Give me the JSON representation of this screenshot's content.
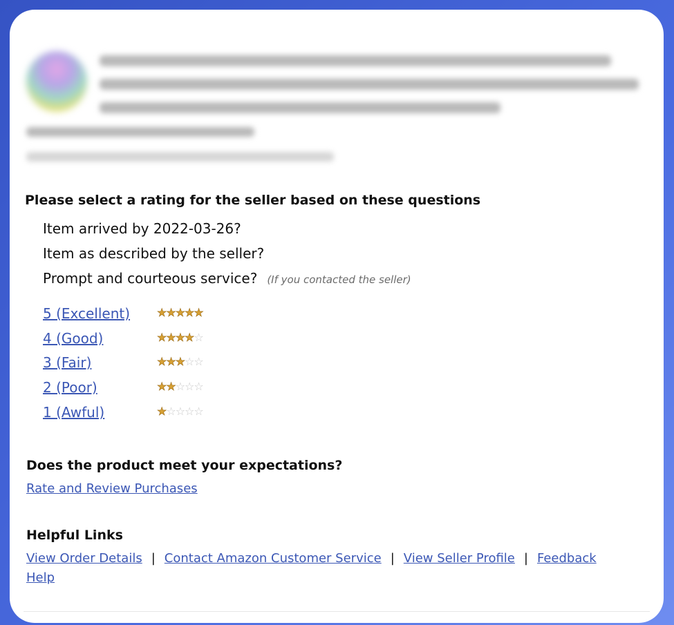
{
  "seller_rating": {
    "title": "Please select a rating for the seller based on these questions",
    "questions": [
      "Item arrived by 2022-03-26?",
      "Item as described by the seller?",
      "Prompt and courteous service?"
    ],
    "question_note": "(If you contacted the seller)",
    "options": [
      {
        "label": "5 (Excellent)",
        "stars": 5
      },
      {
        "label": "4 (Good)",
        "stars": 4
      },
      {
        "label": "3 (Fair)",
        "stars": 3
      },
      {
        "label": "2 (Poor)",
        "stars": 2
      },
      {
        "label": "1 (Awful)",
        "stars": 1
      }
    ],
    "max_stars": 5,
    "star_color": "#d7a033"
  },
  "product_review": {
    "title": "Does the product meet your expectations?",
    "link_label": "Rate and Review Purchases"
  },
  "helpful_links": {
    "title": "Helpful Links",
    "links": [
      "View Order Details",
      "Contact Amazon Customer Service",
      "View Seller Profile",
      "Feedback"
    ],
    "help_label": "Help",
    "separator": "|"
  },
  "colors": {
    "link": "#3b57b5",
    "frame": "#3553c4"
  },
  "icons": [
    "product-thumbnail",
    "star-icon"
  ]
}
